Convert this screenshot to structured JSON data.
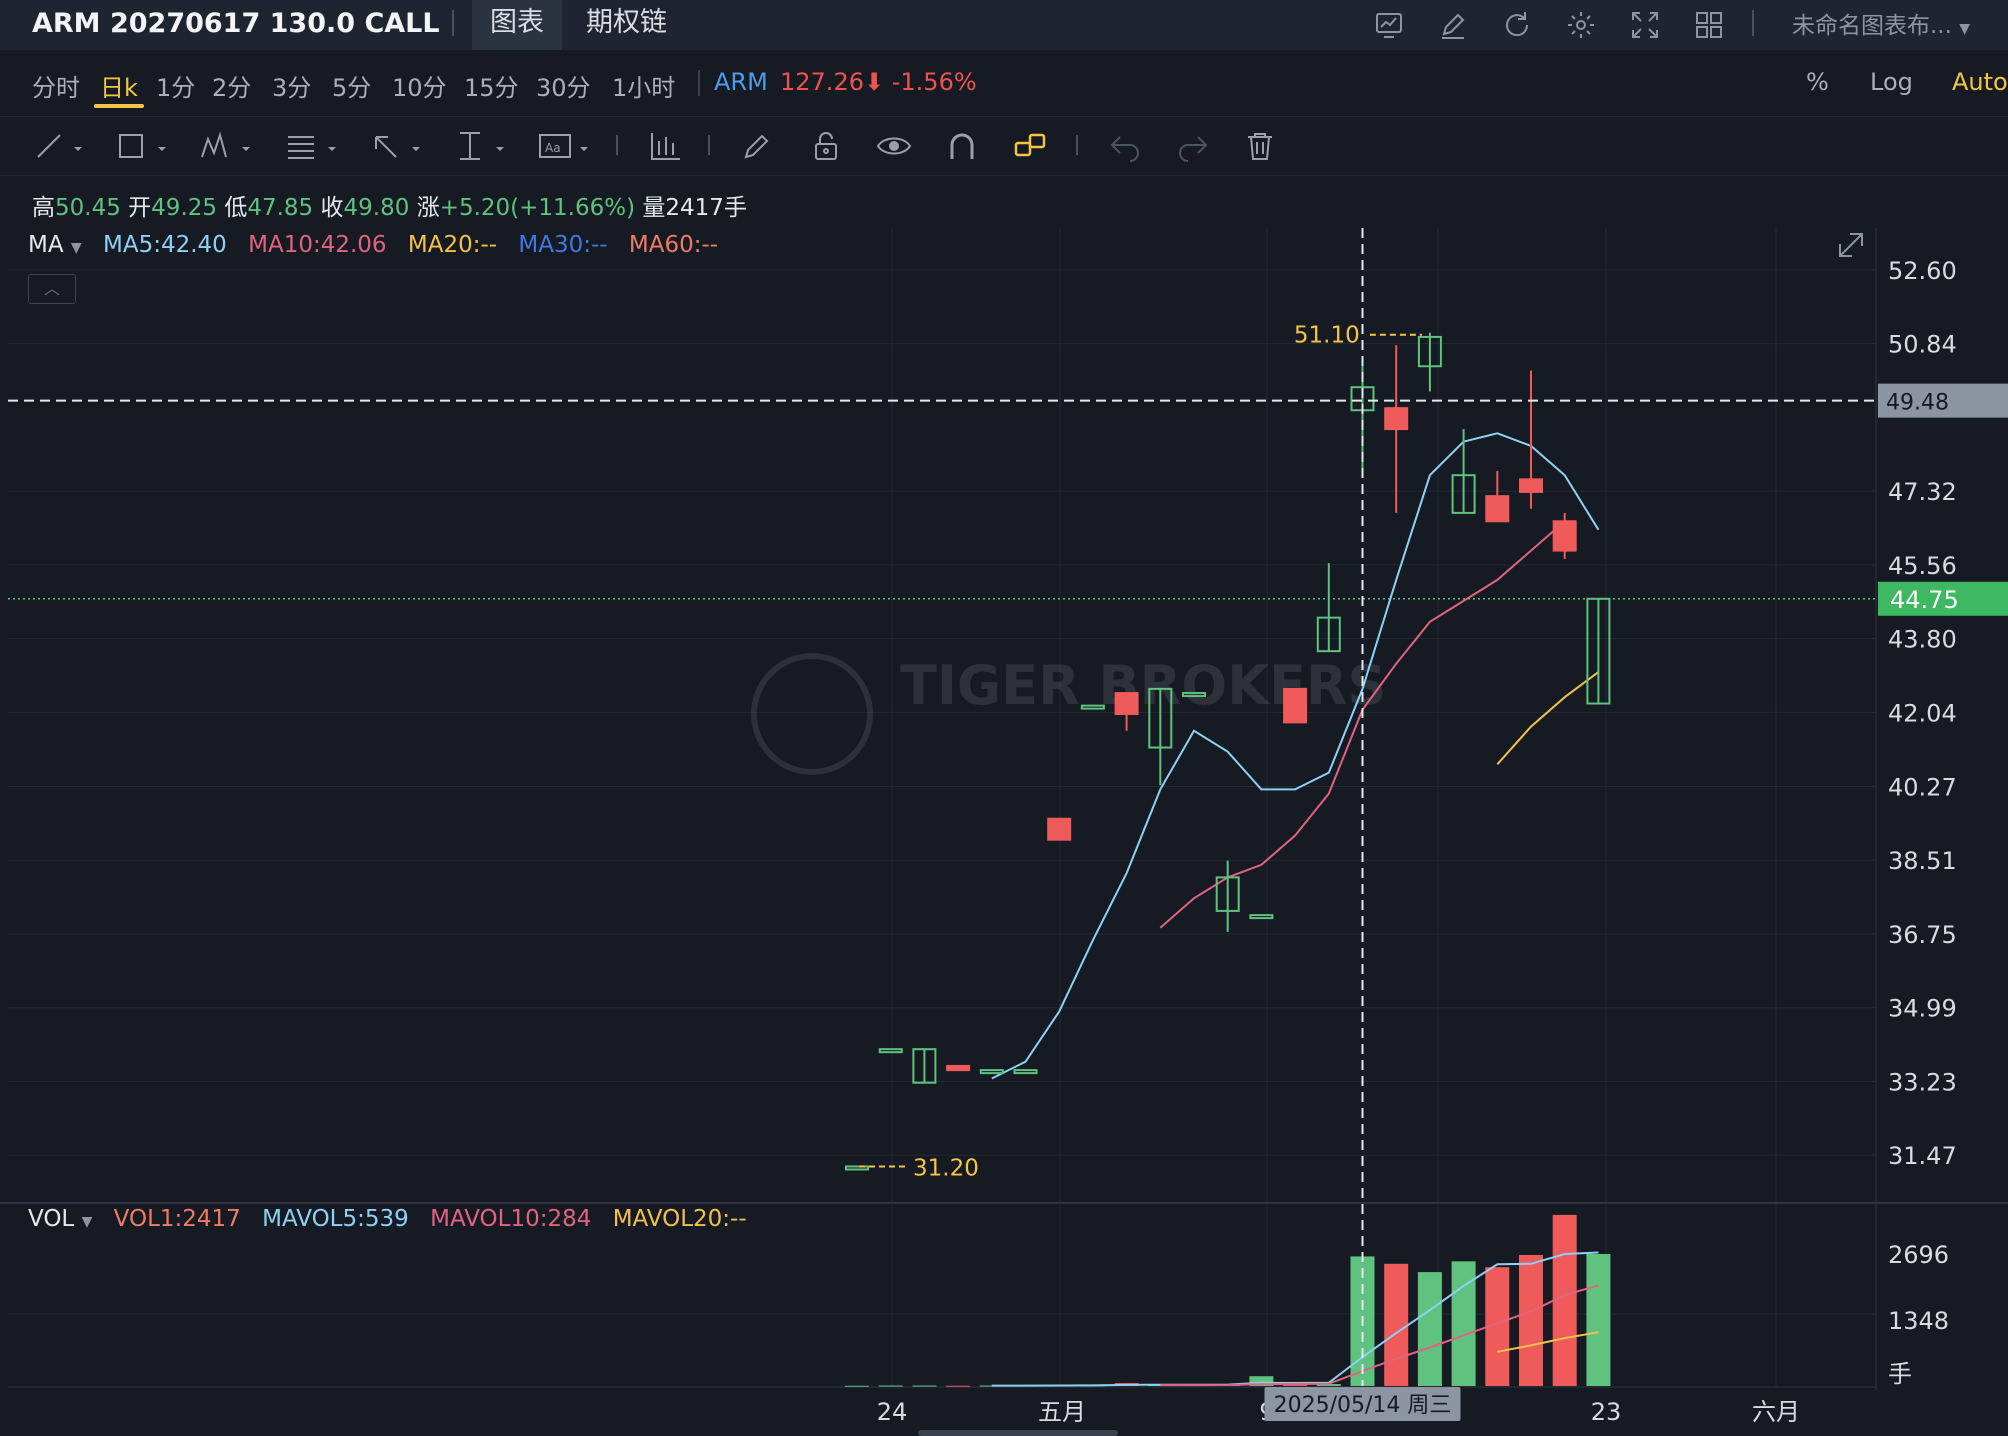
{
  "header": {
    "title": "ARM 20270617 130.0 CALL",
    "tabs": [
      {
        "label": "图表",
        "active": true
      },
      {
        "label": "期权链",
        "active": false
      }
    ],
    "icons": [
      "chart-icon",
      "edit-icon",
      "refresh-icon",
      "settings-icon",
      "fullscreen-icon",
      "grid-layout-icon"
    ],
    "layout_name": "未命名图表布..."
  },
  "timeframes": {
    "items": [
      "分时",
      "日k",
      "1分",
      "2分",
      "3分",
      "5分",
      "10分",
      "15分",
      "30分",
      "1小时"
    ],
    "active": "日k",
    "underlying_symbol": "ARM",
    "underlying_price": "127.26⬇",
    "underlying_change": "-1.56%",
    "right_options": [
      "%",
      "Log",
      "Auto"
    ]
  },
  "drawing_tools": [
    "line-tool-icon",
    "rectangle-tool-icon",
    "pattern-tool-icon",
    "fibonacci-tool-icon",
    "arrow-tool-icon",
    "measure-tool-icon",
    "text-tool-icon",
    "indicator-tool-icon",
    "pencil-icon",
    "lock-icon",
    "eye-icon",
    "magnet-icon",
    "link-icon",
    "undo-icon",
    "redo-icon",
    "trash-icon"
  ],
  "ohlc": {
    "high_label": "高",
    "high": "50.45",
    "open_label": "开",
    "open": "49.25",
    "low_label": "低",
    "low": "47.85",
    "close_label": "收",
    "close": "49.80",
    "change_label": "涨",
    "change": "+5.20(+11.66%)",
    "volume_label": "量",
    "volume": "2417",
    "volume_unit": "手"
  },
  "ma_legend": {
    "name": "MA",
    "items": [
      {
        "text": "MA5:42.40",
        "color": "#8fd0f5"
      },
      {
        "text": "MA10:42.06",
        "color": "#e2637f"
      },
      {
        "text": "MA20:--",
        "color": "#f3c14b"
      },
      {
        "text": "MA30:--",
        "color": "#3f78e0"
      },
      {
        "text": "MA60:--",
        "color": "#f07b63"
      }
    ]
  },
  "vol_legend": {
    "name": "VOL",
    "items": [
      {
        "text": "VOL1:2417",
        "color": "#f07b63"
      },
      {
        "text": "MAVOL5:539",
        "color": "#8fd0f5"
      },
      {
        "text": "MAVOL10:284",
        "color": "#e2637f"
      },
      {
        "text": "MAVOL20:--",
        "color": "#f3c14b"
      }
    ]
  },
  "colors": {
    "up": "#5fc27e",
    "down": "#ef5a5a",
    "accent": "#f6c445",
    "background": "#151a23"
  },
  "watermark": "TIGER BROKERS",
  "chart_data": {
    "type": "candlestick",
    "y_axis_ticks": [
      "52.60",
      "50.84",
      "47.32",
      "45.56",
      "43.80",
      "42.04",
      "40.27",
      "38.51",
      "36.75",
      "34.99",
      "33.23",
      "31.47"
    ],
    "ylim": [
      30.4,
      53.6
    ],
    "x_tick_labels": [
      "24",
      "五月",
      "9",
      "23",
      "六月"
    ],
    "crosshair": {
      "date_label": "2025/05/14 周三",
      "price_label": "49.48"
    },
    "current_price_label": "44.75",
    "max_annotation": "51.10",
    "min_annotation": "31.20",
    "candles": [
      {
        "o": 31.2,
        "h": 31.2,
        "l": 31.2,
        "c": 31.2
      },
      {
        "o": 34.0,
        "h": 34.0,
        "l": 34.0,
        "c": 34.0
      },
      {
        "o": 33.2,
        "h": 34.0,
        "l": 33.2,
        "c": 34.0
      },
      {
        "o": 33.6,
        "h": 33.6,
        "l": 33.5,
        "c": 33.5
      },
      {
        "o": 33.5,
        "h": 33.5,
        "l": 33.5,
        "c": 33.5
      },
      {
        "o": 33.5,
        "h": 33.5,
        "l": 33.5,
        "c": 33.5
      },
      {
        "o": 39.5,
        "h": 39.5,
        "l": 39.0,
        "c": 39.0
      },
      {
        "o": 42.2,
        "h": 42.2,
        "l": 42.2,
        "c": 42.2
      },
      {
        "o": 42.5,
        "h": 42.5,
        "l": 41.6,
        "c": 42.0
      },
      {
        "o": 41.2,
        "h": 42.6,
        "l": 40.3,
        "c": 42.6
      },
      {
        "o": 42.5,
        "h": 42.5,
        "l": 42.5,
        "c": 42.5
      },
      {
        "o": 37.3,
        "h": 38.5,
        "l": 36.8,
        "c": 38.1
      },
      {
        "o": 37.2,
        "h": 37.2,
        "l": 37.2,
        "c": 37.2
      },
      {
        "o": 42.6,
        "h": 42.6,
        "l": 41.8,
        "c": 41.8
      },
      {
        "o": 43.5,
        "h": 45.6,
        "l": 43.5,
        "c": 44.3
      },
      {
        "o": 49.25,
        "h": 50.45,
        "l": 47.85,
        "c": 49.8
      },
      {
        "o": 49.3,
        "h": 50.8,
        "l": 46.8,
        "c": 48.8
      },
      {
        "o": 50.3,
        "h": 51.1,
        "l": 49.7,
        "c": 51.0
      },
      {
        "o": 46.8,
        "h": 48.8,
        "l": 46.8,
        "c": 47.7
      },
      {
        "o": 47.2,
        "h": 47.8,
        "l": 46.6,
        "c": 46.6
      },
      {
        "o": 47.6,
        "h": 50.2,
        "l": 46.9,
        "c": 47.3
      },
      {
        "o": 46.6,
        "h": 46.8,
        "l": 45.7,
        "c": 45.9
      },
      {
        "o": 42.25,
        "h": 44.75,
        "l": 42.25,
        "c": 44.75
      }
    ],
    "ma5": [
      null,
      null,
      null,
      null,
      33.3,
      33.7,
      34.9,
      36.6,
      38.2,
      40.2,
      41.6,
      41.1,
      40.2,
      40.2,
      40.6,
      42.6,
      45.2,
      47.7,
      48.5,
      48.7,
      48.4,
      47.7,
      46.4
    ],
    "ma10": [
      null,
      null,
      null,
      null,
      null,
      null,
      null,
      null,
      null,
      36.9,
      37.6,
      38.1,
      38.4,
      39.1,
      40.1,
      42.1,
      43.2,
      44.2,
      44.7,
      45.2,
      45.9,
      46.6
    ],
    "ma20": [
      null,
      null,
      null,
      null,
      null,
      null,
      null,
      null,
      null,
      null,
      null,
      null,
      null,
      null,
      null,
      null,
      null,
      null,
      null,
      40.8,
      41.7,
      42.4,
      43.0
    ],
    "volume_y_ticks": [
      "2696",
      "1348"
    ],
    "volume_unit": "手",
    "volume_ylim": [
      0,
      3600
    ],
    "volume": [
      5,
      10,
      10,
      5,
      10,
      10,
      20,
      15,
      60,
      20,
      20,
      25,
      200,
      40,
      40,
      2650,
      2500,
      2330,
      2550,
      2430,
      2680,
      3500,
      2700
    ],
    "mavol5": [
      null,
      null,
      null,
      null,
      8,
      9,
      11,
      12,
      23,
      27,
      27,
      28,
      65,
      61,
      65,
      591,
      1082,
      1552,
      2048,
      2490,
      2500,
      2700,
      2730
    ],
    "mavol10": [
      null,
      null,
      null,
      null,
      null,
      null,
      null,
      null,
      null,
      18,
      19,
      20,
      38,
      41,
      44,
      307,
      556,
      788,
      1037,
      1283,
      1525,
      1860,
      2060
    ],
    "mavol20": [
      null,
      null,
      null,
      null,
      null,
      null,
      null,
      null,
      null,
      null,
      null,
      null,
      null,
      null,
      null,
      null,
      null,
      null,
      null,
      700,
      830,
      980,
      1100
    ]
  }
}
